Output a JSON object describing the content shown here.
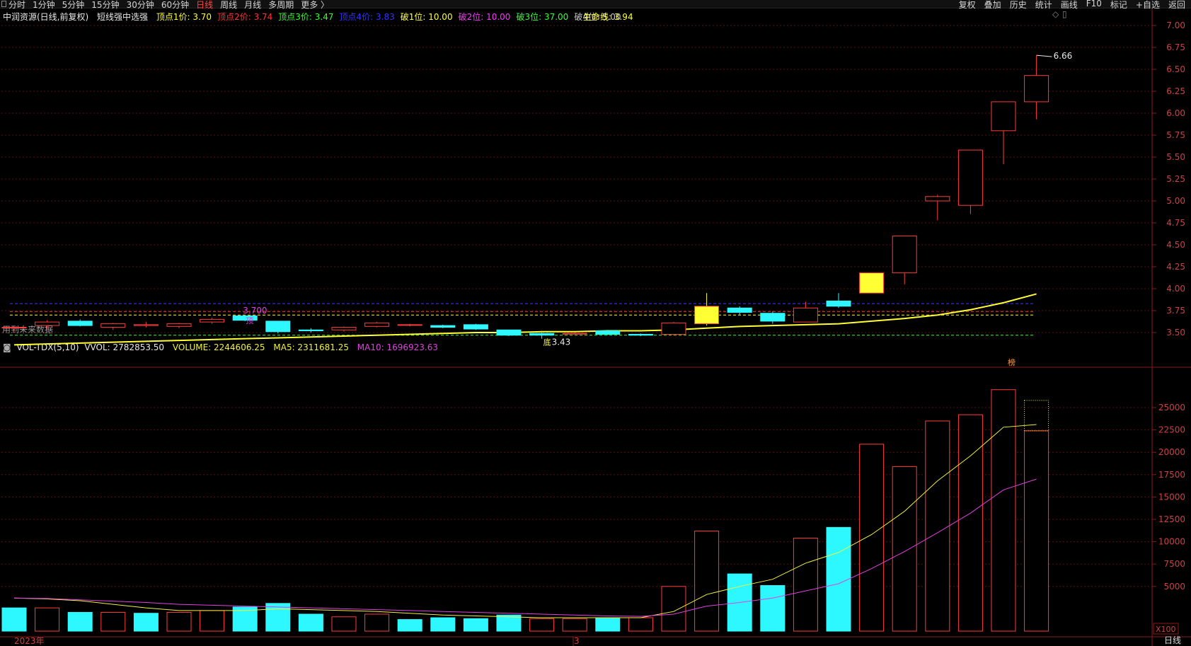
{
  "menu": {
    "left": [
      "分时",
      "1分钟",
      "5分钟",
      "15分钟",
      "30分钟",
      "60分钟",
      "日线",
      "周线",
      "月线",
      "多周期",
      "更多 〉"
    ],
    "active": "日线",
    "right": [
      "复权",
      "叠加",
      "历史",
      "统计",
      "画线",
      "F10",
      "标记",
      "+自选",
      "返回"
    ]
  },
  "title": "中润资源(日线,前复权)",
  "indicator_name": "短线强中选强",
  "levels": [
    {
      "label": "顶点1价: 3.70",
      "color": "#ffff33"
    },
    {
      "label": "顶点2价: 3.74",
      "color": "#ff3333"
    },
    {
      "label": "顶点3价: 3.47",
      "color": "#33ff33"
    },
    {
      "label": "顶点4价: 3.83",
      "color": "#3333ff"
    },
    {
      "label": "破1位: 10.00",
      "color": "#ffff33"
    },
    {
      "label": "破2位: 10.00",
      "color": "#ff33ff"
    },
    {
      "label": "破3位: 37.00",
      "color": "#33ff33"
    },
    {
      "label": "破4位: 5.00",
      "color": "#c8c8c8"
    }
  ],
  "lifeline": "生命线: 3.94",
  "future_note": "用到未来数据",
  "price_labels": {
    "max": "6.66",
    "min": "3.43",
    "min_prefix": "底",
    "top_val": "3.700",
    "top_tag": "顶",
    "bottom_tag": "榜"
  },
  "vol_legend": {
    "name": "VOL-TDX(5,10)",
    "vvol": "VVOL: 2782853.50",
    "volume": "VOLUME: 2244606.25",
    "ma5": "MA5: 2311681.25",
    "ma10": "MA10: 1696923.63"
  },
  "x_labels": {
    "start": "2023年",
    "mid": "3"
  },
  "unit_label": "X100",
  "bottom_tab": "日线",
  "colors": {
    "up": "#ff3b3b",
    "down": "#2ef8ff",
    "ma5": "#f0f040",
    "ma10": "#e040e0",
    "life": "#ffff33",
    "grid": "#5a1010"
  },
  "chart_data": [
    {
      "type": "candlestick",
      "ylim": [
        3.3,
        7.1
      ],
      "yticks": [
        3.5,
        3.75,
        4.0,
        4.25,
        4.5,
        4.75,
        5.0,
        5.25,
        5.5,
        5.75,
        6.0,
        6.25,
        6.5,
        6.75,
        7.0
      ],
      "candles": [
        {
          "o": 3.56,
          "h": 3.58,
          "l": 3.52,
          "c": 3.56
        },
        {
          "o": 3.58,
          "h": 3.64,
          "l": 3.54,
          "c": 3.62
        },
        {
          "o": 3.63,
          "h": 3.65,
          "l": 3.57,
          "c": 3.58
        },
        {
          "o": 3.56,
          "h": 3.61,
          "l": 3.53,
          "c": 3.6
        },
        {
          "o": 3.58,
          "h": 3.62,
          "l": 3.56,
          "c": 3.59
        },
        {
          "o": 3.57,
          "h": 3.61,
          "l": 3.55,
          "c": 3.6
        },
        {
          "o": 3.62,
          "h": 3.67,
          "l": 3.6,
          "c": 3.65
        },
        {
          "o": 3.69,
          "h": 3.7,
          "l": 3.63,
          "c": 3.64
        },
        {
          "o": 3.63,
          "h": 3.63,
          "l": 3.49,
          "c": 3.51
        },
        {
          "o": 3.53,
          "h": 3.55,
          "l": 3.5,
          "c": 3.52
        },
        {
          "o": 3.53,
          "h": 3.57,
          "l": 3.51,
          "c": 3.56
        },
        {
          "o": 3.57,
          "h": 3.62,
          "l": 3.56,
          "c": 3.61
        },
        {
          "o": 3.59,
          "h": 3.6,
          "l": 3.57,
          "c": 3.59
        },
        {
          "o": 3.58,
          "h": 3.59,
          "l": 3.55,
          "c": 3.56
        },
        {
          "o": 3.59,
          "h": 3.6,
          "l": 3.53,
          "c": 3.54
        },
        {
          "o": 3.53,
          "h": 3.53,
          "l": 3.46,
          "c": 3.47
        },
        {
          "o": 3.49,
          "h": 3.5,
          "l": 3.43,
          "c": 3.47
        },
        {
          "o": 3.49,
          "h": 3.5,
          "l": 3.48,
          "c": 3.49
        },
        {
          "o": 3.52,
          "h": 3.53,
          "l": 3.47,
          "c": 3.48
        },
        {
          "o": 3.48,
          "h": 3.49,
          "l": 3.46,
          "c": 3.47
        },
        {
          "o": 3.48,
          "h": 3.62,
          "l": 3.47,
          "c": 3.61
        },
        {
          "o": 3.6,
          "h": 3.95,
          "l": 3.58,
          "c": 3.8
        },
        {
          "o": 3.78,
          "h": 3.8,
          "l": 3.7,
          "c": 3.73
        },
        {
          "o": 3.72,
          "h": 3.74,
          "l": 3.6,
          "c": 3.63
        },
        {
          "o": 3.62,
          "h": 3.85,
          "l": 3.62,
          "c": 3.78
        },
        {
          "o": 3.86,
          "h": 3.95,
          "l": 3.78,
          "c": 3.8
        },
        {
          "o": 3.95,
          "h": 4.18,
          "l": 3.95,
          "c": 4.18
        },
        {
          "o": 4.18,
          "h": 4.6,
          "l": 4.05,
          "c": 4.6
        },
        {
          "o": 5.0,
          "h": 5.07,
          "l": 4.78,
          "c": 5.05
        },
        {
          "o": 4.95,
          "h": 5.58,
          "l": 4.85,
          "c": 5.58
        },
        {
          "o": 5.8,
          "h": 6.13,
          "l": 5.42,
          "c": 6.13
        },
        {
          "o": 6.13,
          "h": 6.66,
          "l": 5.93,
          "c": 6.43
        }
      ],
      "limit_up_days": [
        21,
        26
      ],
      "lifeline": [
        3.36,
        3.37,
        3.38,
        3.39,
        3.4,
        3.41,
        3.42,
        3.43,
        3.44,
        3.45,
        3.46,
        3.47,
        3.48,
        3.49,
        3.5,
        3.5,
        3.51,
        3.51,
        3.52,
        3.52,
        3.53,
        3.55,
        3.57,
        3.58,
        3.59,
        3.6,
        3.63,
        3.66,
        3.7,
        3.76,
        3.84,
        3.94
      ],
      "hlines": [
        {
          "v": 3.83,
          "color": "#3b3bff"
        },
        {
          "v": 3.74,
          "color": "#ff3b3b"
        },
        {
          "v": 3.7,
          "color": "#ffff33"
        },
        {
          "v": 3.47,
          "color": "#33ff33"
        }
      ]
    },
    {
      "type": "bar",
      "ylim": [
        0,
        28000
      ],
      "yticks": [
        5000,
        7500,
        10000,
        12500,
        15000,
        17500,
        20000,
        22500,
        25000
      ],
      "values": [
        2600,
        2600,
        2100,
        2100,
        2000,
        2100,
        2300,
        2700,
        3100,
        1900,
        1600,
        1900,
        1300,
        1500,
        1400,
        1800,
        1400,
        1400,
        1500,
        1500,
        5000,
        11200,
        6400,
        5100,
        10400,
        11600,
        20900,
        18400,
        23500,
        24200,
        27000,
        22400
      ],
      "up": [
        false,
        true,
        false,
        true,
        false,
        true,
        true,
        false,
        false,
        false,
        true,
        true,
        false,
        false,
        false,
        false,
        true,
        true,
        false,
        true,
        true,
        true,
        false,
        false,
        true,
        false,
        true,
        true,
        true,
        true,
        true,
        true
      ],
      "ma5": [
        3700,
        3600,
        3400,
        3000,
        2600,
        2300,
        2300,
        2300,
        2500,
        2400,
        2300,
        2200,
        2000,
        1800,
        1700,
        1600,
        1500,
        1500,
        1500,
        1500,
        2200,
        4100,
        5000,
        5800,
        7600,
        8800,
        10800,
        13400,
        16800,
        19600,
        22800,
        23100
      ],
      "ma10": [
        3700,
        3650,
        3500,
        3350,
        3200,
        3000,
        2900,
        2800,
        2700,
        2600,
        2500,
        2400,
        2300,
        2200,
        2100,
        2000,
        1900,
        1800,
        1700,
        1650,
        1900,
        2800,
        3200,
        3700,
        4500,
        5300,
        7000,
        8900,
        11000,
        13200,
        15800,
        17000
      ],
      "phantom": 25800
    }
  ]
}
